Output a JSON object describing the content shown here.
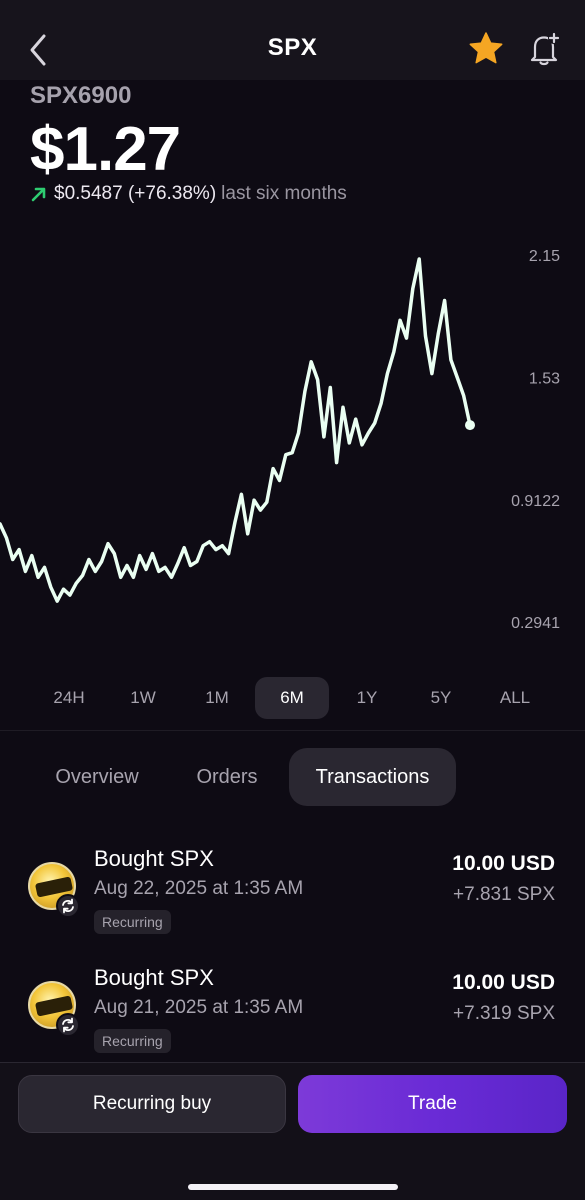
{
  "header": {
    "title": "SPX",
    "back_icon": "chevron-left-icon",
    "favorite_icon": "star-icon",
    "alert_icon": "bell-plus-icon",
    "favorite_color": "#f5a623"
  },
  "asset": {
    "name": "SPX6900",
    "price": "$1.27",
    "change_value": "$0.5487 (+76.38%)",
    "change_period": "last six months",
    "up_color": "#2ecc71"
  },
  "chart_data": {
    "type": "line",
    "title": "",
    "xlabel": "",
    "ylabel": "",
    "y_tick_labels": [
      "2.15",
      "1.53",
      "0.9122",
      "0.2941"
    ],
    "y_ticks": [
      2.15,
      1.53,
      0.9122,
      0.2941
    ],
    "ylim": [
      0.2941,
      2.15
    ],
    "grid": false,
    "series": [
      {
        "values": [
          0.79,
          0.72,
          0.61,
          0.66,
          0.55,
          0.63,
          0.52,
          0.57,
          0.47,
          0.4,
          0.46,
          0.43,
          0.49,
          0.53,
          0.61,
          0.55,
          0.6,
          0.69,
          0.64,
          0.52,
          0.58,
          0.52,
          0.63,
          0.56,
          0.64,
          0.55,
          0.57,
          0.52,
          0.59,
          0.67,
          0.58,
          0.6,
          0.68,
          0.7,
          0.66,
          0.68,
          0.64,
          0.8,
          0.94,
          0.74,
          0.91,
          0.86,
          0.9,
          1.07,
          1.01,
          1.14,
          1.15,
          1.25,
          1.46,
          1.61,
          1.52,
          1.23,
          1.48,
          1.1,
          1.38,
          1.2,
          1.32,
          1.19,
          1.25,
          1.3,
          1.4,
          1.55,
          1.66,
          1.82,
          1.73,
          1.98,
          2.13,
          1.74,
          1.55,
          1.75,
          1.92,
          1.62,
          1.53,
          1.44,
          1.29
        ],
        "color": "#eafff2"
      }
    ]
  },
  "ranges": {
    "items": [
      "24H",
      "1W",
      "1M",
      "6M",
      "1Y",
      "5Y",
      "ALL"
    ],
    "active": "6M"
  },
  "tabs": {
    "items": [
      "Overview",
      "Orders",
      "Transactions"
    ],
    "active": "Transactions"
  },
  "transactions": [
    {
      "title": "Bought SPX",
      "date": "Aug 22, 2025 at 1:35 AM",
      "tag": "Recurring",
      "amount": "10.00 USD",
      "quantity": "+7.831 SPX",
      "icon": "spx6900-logo-icon",
      "badge_icon": "recurring-icon"
    },
    {
      "title": "Bought SPX",
      "date": "Aug 21, 2025 at 1:35 AM",
      "tag": "Recurring",
      "amount": "10.00 USD",
      "quantity": "+7.319 SPX",
      "icon": "spx6900-logo-icon",
      "badge_icon": "recurring-icon"
    }
  ],
  "footer": {
    "recurring_label": "Recurring buy",
    "trade_label": "Trade",
    "trade_color": "#6a2bd6"
  }
}
